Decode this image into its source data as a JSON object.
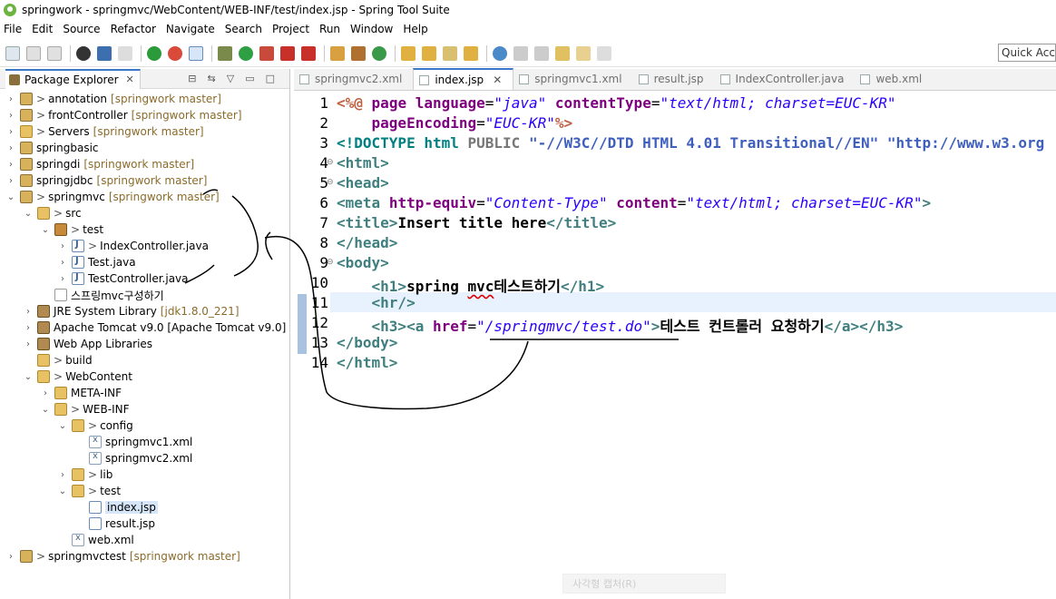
{
  "window": {
    "title": "springwork - springmvc/WebContent/WEB-INF/test/index.jsp - Spring Tool Suite"
  },
  "menu": [
    "File",
    "Edit",
    "Source",
    "Refactor",
    "Navigate",
    "Search",
    "Project",
    "Run",
    "Window",
    "Help"
  ],
  "toolbar": {
    "quick_access": "Quick Access"
  },
  "package_explorer": {
    "title": "Package Explorer",
    "tree": [
      {
        "label": "annotation",
        "git": "[springwork master]",
        "icon": "project"
      },
      {
        "label": "frontController",
        "git": "[springwork master]",
        "icon": "project"
      },
      {
        "label": "Servers",
        "git": "[springwork master]",
        "icon": "folder"
      },
      {
        "label": "springbasic",
        "git": "",
        "icon": "project"
      },
      {
        "label": "springdi",
        "git": "[springwork master]",
        "icon": "project"
      },
      {
        "label": "springjdbc",
        "git": "[springwork master]",
        "icon": "project"
      },
      {
        "label": "springmvc",
        "git": "[springwork master]",
        "icon": "project"
      },
      {
        "label": "src",
        "git": "",
        "icon": "folder"
      },
      {
        "label": "test",
        "git": "",
        "icon": "pkg"
      },
      {
        "label": "IndexController.java",
        "git": "",
        "icon": "java"
      },
      {
        "label": "Test.java",
        "git": "",
        "icon": "java"
      },
      {
        "label": "TestController.java",
        "git": "",
        "icon": "java"
      },
      {
        "label": "스프링mvc구성하기",
        "git": "",
        "icon": "file"
      },
      {
        "label": "JRE System Library",
        "git": "[jdk1.8.0_221]",
        "icon": "lib"
      },
      {
        "label": "Apache Tomcat v9.0 [Apache Tomcat v9.0]",
        "git": "",
        "icon": "lib"
      },
      {
        "label": "Web App Libraries",
        "git": "",
        "icon": "lib"
      },
      {
        "label": "build",
        "git": "",
        "icon": "folder"
      },
      {
        "label": "WebContent",
        "git": "",
        "icon": "folder"
      },
      {
        "label": "META-INF",
        "git": "",
        "icon": "folder"
      },
      {
        "label": "WEB-INF",
        "git": "",
        "icon": "folder"
      },
      {
        "label": "config",
        "git": "",
        "icon": "folder"
      },
      {
        "label": "springmvc1.xml",
        "git": "",
        "icon": "xml"
      },
      {
        "label": "springmvc2.xml",
        "git": "",
        "icon": "xml"
      },
      {
        "label": "lib",
        "git": "",
        "icon": "folder"
      },
      {
        "label": "test",
        "git": "",
        "icon": "folder"
      },
      {
        "label": "index.jsp",
        "git": "",
        "icon": "jsp"
      },
      {
        "label": "result.jsp",
        "git": "",
        "icon": "jsp"
      },
      {
        "label": "web.xml",
        "git": "",
        "icon": "xml"
      },
      {
        "label": "springmvctest",
        "git": "[springwork master]",
        "icon": "project"
      }
    ]
  },
  "editor": {
    "tabs": [
      "springmvc2.xml",
      "index.jsp",
      "springmvc1.xml",
      "result.jsp",
      "IndexController.java",
      "web.xml"
    ],
    "active_tab": "index.jsp",
    "line_numbers": [
      "1",
      "2",
      "3",
      "4",
      "5",
      "6",
      "7",
      "8",
      "9",
      "10",
      "11",
      "12",
      "13",
      "14"
    ]
  },
  "ghost_popup": "사각형 캡처(R)"
}
